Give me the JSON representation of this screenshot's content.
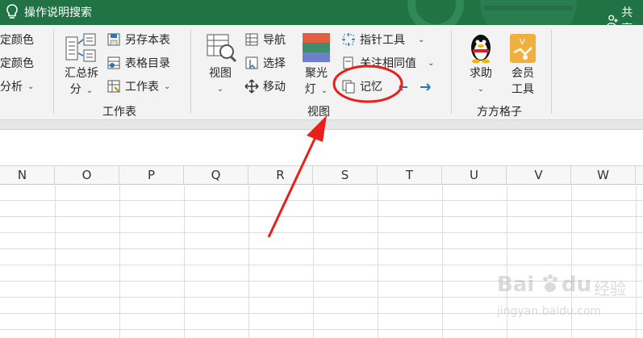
{
  "titlebar": {
    "search_label": "操作说明搜索",
    "share_label": "共享",
    "bg_color": "#217346"
  },
  "ribbon": {
    "left_partial": {
      "item1": "定颜色",
      "item2": "定颜色",
      "item3": "分析"
    },
    "worksheet_group": {
      "summary_split_line1": "汇总拆",
      "summary_split_line2": "分",
      "save_as": "另存本表",
      "table_directory": "表格目录",
      "worksheet": "工作表",
      "label": "工作表"
    },
    "view_group": {
      "view": "视图",
      "navigate": "导航",
      "select": "选择",
      "move": "移动",
      "spotlight_line1": "聚光",
      "spotlight_line2": "灯",
      "pointer_tool": "指针工具",
      "focus_same": "关注相同值",
      "memory": "记忆",
      "label": "视图"
    },
    "fangfang_group": {
      "help": "求助",
      "member_line1": "会员",
      "member_line2": "工具",
      "label": "方方格子"
    }
  },
  "grid": {
    "columns": [
      "N",
      "O",
      "P",
      "Q",
      "R",
      "S",
      "T",
      "U",
      "V",
      "W"
    ]
  },
  "watermark": {
    "brand": "Bai",
    "brand2": "du",
    "experience": "经验",
    "url": "jingyan.baidu.com"
  },
  "colors": {
    "accent_green": "#217346",
    "annotation_red": "#e8201a",
    "arrow_blue": "#2e75b6"
  }
}
